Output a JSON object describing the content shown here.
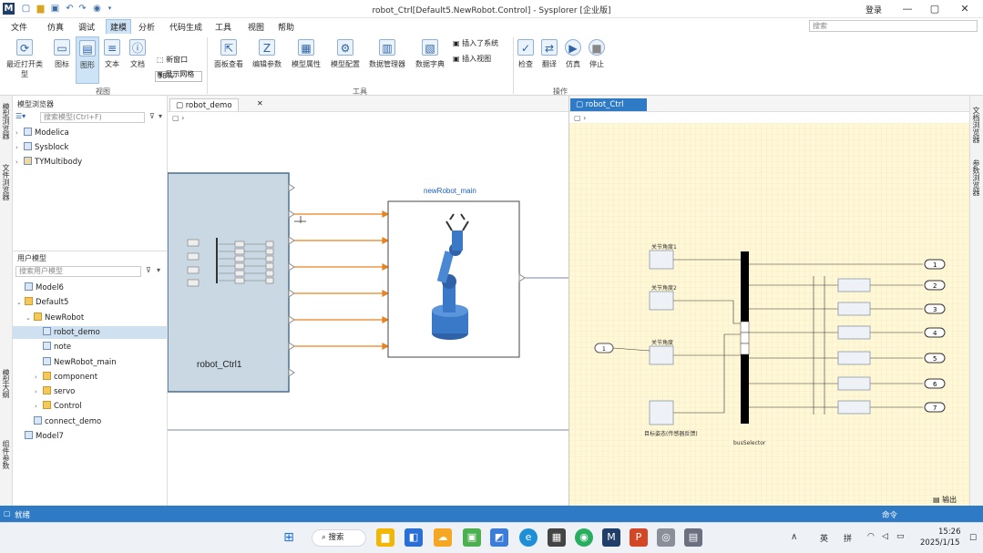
{
  "window": {
    "title": "robot_Ctrl[Default5.NewRobot.Control] - Sysplorer [企业版]",
    "login": "登录",
    "min_icon": "minimize-icon",
    "max_icon": "maximize-icon",
    "close_icon": "close-icon"
  },
  "menu": [
    "文件",
    "仿真",
    "调试",
    "建模",
    "分析",
    "代码生成",
    "工具",
    "视图",
    "帮助"
  ],
  "menu_active_index": 3,
  "search": {
    "placeholder": "搜索"
  },
  "ribbon": {
    "buttons": [
      {
        "label": "最近打开类型",
        "icon": "recent-icon"
      },
      {
        "label": "图标",
        "icon": "icon-view-icon"
      },
      {
        "label": "图形",
        "icon": "diagram-view-icon"
      },
      {
        "label": "文本",
        "icon": "text-view-icon"
      },
      {
        "label": "文档",
        "icon": "doc-view-icon"
      },
      {
        "label": "面板查看",
        "icon": "panel-icon"
      },
      {
        "label": "编辑参数",
        "icon": "edit-param-icon"
      },
      {
        "label": "模型属性",
        "icon": "model-prop-icon"
      },
      {
        "label": "模型配置",
        "icon": "model-config-icon"
      },
      {
        "label": "数据管理器",
        "icon": "data-mgr-icon"
      },
      {
        "label": "数据字典",
        "icon": "data-dict-icon"
      },
      {
        "label": "检查",
        "icon": "check-icon"
      },
      {
        "label": "翻译",
        "icon": "translate-icon"
      },
      {
        "label": "仿真",
        "icon": "simulate-icon"
      },
      {
        "label": "停止",
        "icon": "stop-icon"
      }
    ],
    "zoom": "38%",
    "small": {
      "new_window": "新窗口",
      "show_grid": "显示网格",
      "insert_sys": "插入了系统",
      "insert_view": "插入视图"
    },
    "groups": {
      "view": "视图",
      "tools": "工具",
      "operate": "操作"
    }
  },
  "left_vertical_tabs": [
    "模型浏览器",
    "文件浏览器",
    "模型大纲",
    "组件参数"
  ],
  "lib_panel": {
    "title": "模型浏览器",
    "search_placeholder": "搜索模型(Ctrl+F)",
    "items": [
      "Modelica",
      "Sysblock",
      "TYMultibody"
    ]
  },
  "user_panel": {
    "title": "用户模型",
    "search_placeholder": "搜索用户模型",
    "items": [
      {
        "label": "Model6",
        "level": 0,
        "type": "model"
      },
      {
        "label": "Default5",
        "level": 0,
        "type": "package",
        "expanded": true
      },
      {
        "label": "NewRobot",
        "level": 1,
        "type": "package",
        "expanded": true
      },
      {
        "label": "robot_demo",
        "level": 2,
        "type": "model",
        "selected": true
      },
      {
        "label": "note",
        "level": 2,
        "type": "model"
      },
      {
        "label": "NewRobot_main",
        "level": 2,
        "type": "model"
      },
      {
        "label": "component",
        "level": 2,
        "type": "package"
      },
      {
        "label": "servo",
        "level": 2,
        "type": "package"
      },
      {
        "label": "Control",
        "level": 2,
        "type": "package"
      },
      {
        "label": "connect_demo",
        "level": 1,
        "type": "model"
      },
      {
        "label": "Model7",
        "level": 0,
        "type": "model"
      }
    ]
  },
  "tab_left": "robot_demo",
  "tab_right": "robot_Ctrl",
  "left_diagram": {
    "block_ctrl_label": "robot_Ctrl1",
    "block_robot_title": "newRobot_main"
  },
  "right_diagram": {
    "inputs": [
      "关节角度1",
      "关节角度2",
      "关节角度",
      "目标姿态(传感器反馈)"
    ],
    "outputs": [
      "1",
      "2",
      "3",
      "4",
      "5",
      "6",
      "7"
    ],
    "bus_label": "busSelector",
    "in_label": "1"
  },
  "right_vertical_tabs": [
    "文档浏览器",
    "参数浏览器"
  ],
  "statusbar": {
    "left": "就绪",
    "right": "命令",
    "output": "输出"
  },
  "taskbar": {
    "search": "搜索",
    "ime1": "英",
    "ime2": "拼",
    "time": "15:26",
    "date": "2025/1/15"
  },
  "colors": {
    "accent": "#2f7ac4",
    "diagram_grid": "#fff5c8",
    "block_ctrl": "#c9d8e3",
    "connector": "#e8821e"
  }
}
